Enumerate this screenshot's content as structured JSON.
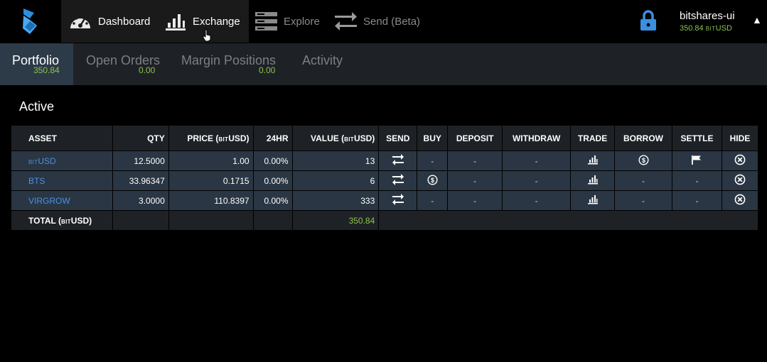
{
  "nav": {
    "dashboard": "Dashboard",
    "exchange": "Exchange",
    "explore": "Explore",
    "send": "Send (Beta)"
  },
  "account": {
    "name": "bitshares-ui",
    "balance_value": "350.84",
    "balance_prefix": "BIT",
    "balance_unit": "USD"
  },
  "tabs": [
    {
      "label": "Portfolio",
      "value": "350.84"
    },
    {
      "label": "Open Orders",
      "value": "0.00"
    },
    {
      "label": "Margin Positions",
      "value": "0.00"
    },
    {
      "label": "Activity"
    }
  ],
  "section": {
    "title": "Active"
  },
  "table": {
    "headers": {
      "asset": "ASSET",
      "qty": "QTY",
      "price_pre": "PRICE (",
      "price_bit": "BIT",
      "price_post": "USD)",
      "change": "24HR",
      "value_pre": "VALUE (",
      "value_bit": "BIT",
      "value_post": "USD)",
      "send": "SEND",
      "buy": "BUY",
      "deposit": "DEPOSIT",
      "withdraw": "WITHDRAW",
      "trade": "TRADE",
      "borrow": "BORROW",
      "settle": "SETTLE",
      "hide": "HIDE"
    },
    "rows": [
      {
        "asset_bit": "BIT",
        "asset": "USD",
        "qty": "12.5000",
        "price": "1.00",
        "change": "0.00%",
        "value": "13",
        "buy": "-",
        "deposit": "-",
        "withdraw": "-"
      },
      {
        "asset": "BTS",
        "qty": "33.96347",
        "price": "0.1715",
        "change": "0.00%",
        "value": "6",
        "deposit": "-",
        "withdraw": "-",
        "borrow": "-",
        "settle": "-"
      },
      {
        "asset": "VIRGROW",
        "qty": "3.0000",
        "price": "110.8397",
        "change": "0.00%",
        "value": "333",
        "buy": "-",
        "deposit": "-",
        "withdraw": "-",
        "borrow": "-",
        "settle": "-"
      }
    ],
    "total": {
      "label_pre": "TOTAL (",
      "label_bit": "BIT",
      "label_post": "USD)",
      "value": "350.84"
    }
  },
  "icons": {
    "logo": "bitshares-logo-icon",
    "dashboard": "speedometer-icon",
    "exchange": "bar-chart-icon",
    "explore": "server-stack-icon",
    "send": "transfer-arrows-icon",
    "lock": "lock-icon",
    "caret": "caret-up-icon"
  },
  "colors": {
    "accent_green": "#8bc34a",
    "link_blue": "#4a90e2",
    "row_bg": "#2a3643",
    "header_bg": "#1e2226",
    "lock_blue": "#3b8fe0"
  }
}
